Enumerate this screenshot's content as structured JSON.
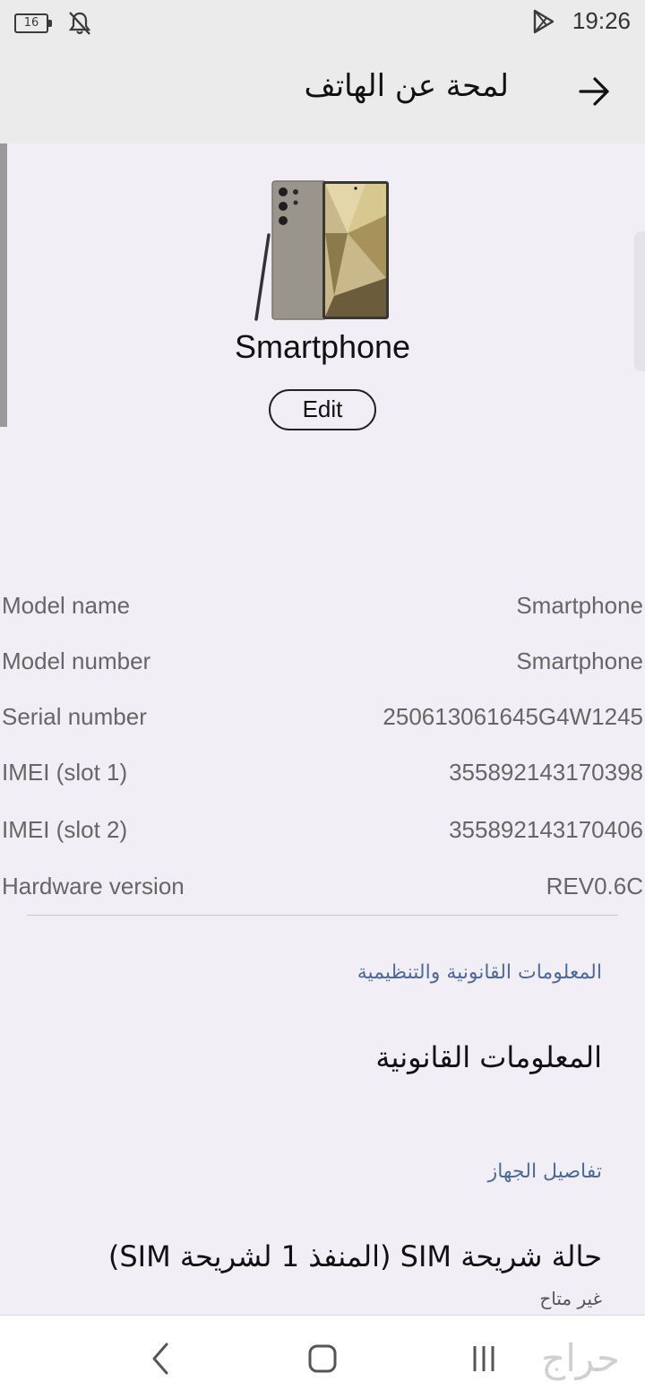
{
  "status_bar": {
    "battery_level": "16",
    "time": "19:26",
    "icons": [
      "battery-icon",
      "mute-bell-icon",
      "play-store-icon"
    ]
  },
  "app_bar": {
    "title": "لمحة عن الهاتف"
  },
  "device": {
    "name": "Smartphone",
    "edit_label": "Edit"
  },
  "info_rows": [
    {
      "label": "Model name",
      "value": "Smartphone"
    },
    {
      "label": "Model number",
      "value": "Smartphone"
    },
    {
      "label": "Serial number",
      "value": "250613061645G4W1245"
    },
    {
      "label": "IMEI (slot 1)",
      "value": "355892143170398"
    },
    {
      "label": "IMEI (slot 2)",
      "value": "355892143170406"
    },
    {
      "label": "Hardware version",
      "value": "REV0.6C"
    }
  ],
  "legal": {
    "section_header": "المعلومات القانونية والتنظيمية",
    "item_title": "المعلومات القانونية"
  },
  "device_details": {
    "section_header": "تفاصيل الجهاز",
    "sim_title": "حالة شريحة SIM (المنفذ 1 لشريحة SIM)",
    "sim_status": "غير متاح"
  },
  "watermark": "حراج"
}
